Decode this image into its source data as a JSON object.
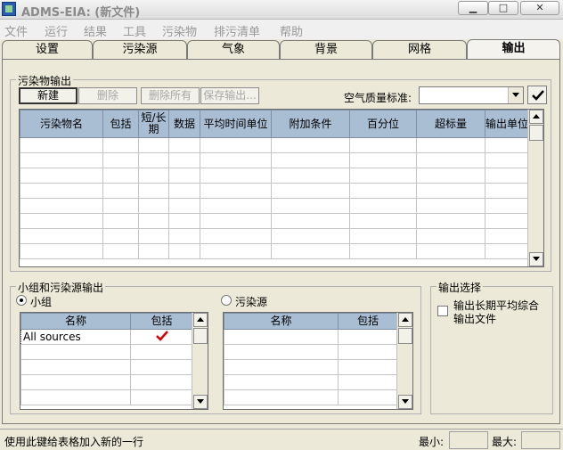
{
  "window": {
    "title": "ADMS-EIA: (新文件)"
  },
  "menu": [
    "文件",
    "运行",
    "结果",
    "工具",
    "污染物",
    "排污清单",
    "帮助"
  ],
  "tabs": [
    {
      "label": "设置"
    },
    {
      "label": "污染源"
    },
    {
      "label": "气象"
    },
    {
      "label": "背景"
    },
    {
      "label": "网格"
    },
    {
      "label": "输出",
      "active": true
    }
  ],
  "pollutant_output": {
    "group_label": "污染物输出",
    "buttons": {
      "new": "新建",
      "delete": "删除",
      "delete_all": "删除所有",
      "save_output": "保存输出..."
    },
    "aq_standard_label": "空气质量标准:",
    "aq_standard_value": "",
    "columns": {
      "name": "污染物名",
      "include": "包括",
      "short_long": "短/长期",
      "data": "数据",
      "avg_time_unit": "平均时间单位",
      "extra": "附加条件",
      "percentile": "百分位",
      "exceedance": "超标量",
      "output_unit": "输出单位"
    }
  },
  "group_source_output": {
    "group_label": "小组和污染源输出",
    "radio_group": "小组",
    "radio_source": "污染源",
    "group_table": {
      "col_name": "名称",
      "col_include": "包括",
      "rows": [
        {
          "name": "All sources",
          "include": true
        }
      ]
    },
    "source_table": {
      "col_name": "名称",
      "col_include": "包括"
    }
  },
  "output_options": {
    "group_label": "输出选择",
    "checkbox_label_line1": "输出长期平均综合",
    "checkbox_label_line2": "输出文件"
  },
  "statusbar": {
    "message": "使用此键给表格加入新的一行",
    "min_label": "最小:",
    "max_label": "最大:"
  },
  "colors": {
    "grid_header": "#a9bdd3",
    "check_mark": "#d40000",
    "panel_bg": "#ece9d8"
  }
}
